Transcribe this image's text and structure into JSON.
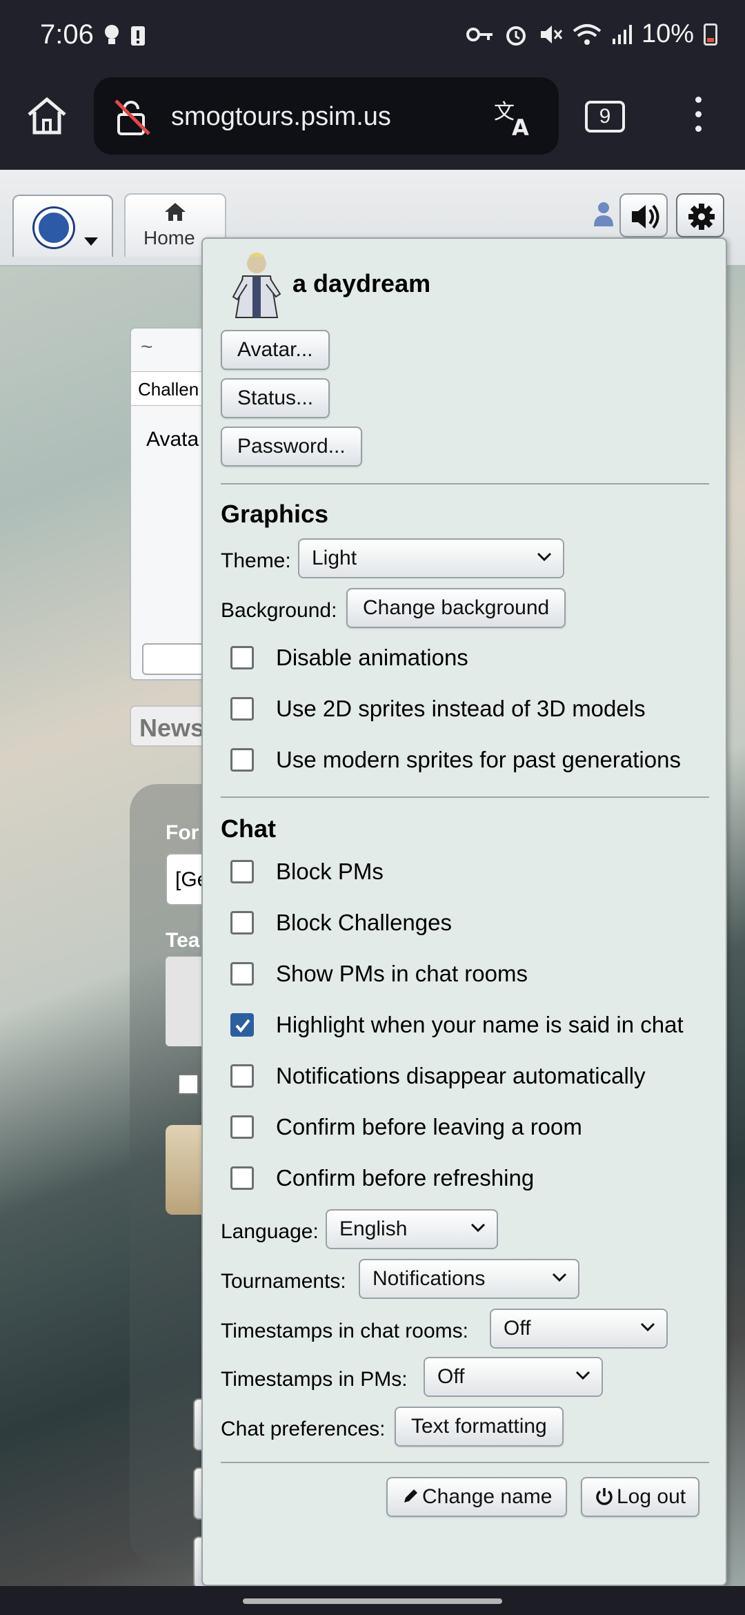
{
  "status_bar": {
    "time": "7:06",
    "battery": "10%"
  },
  "browser": {
    "url": "smogtours.psim.us",
    "tab_count": "9"
  },
  "site": {
    "home_tab": "Home"
  },
  "background": {
    "tilde": "~",
    "challenge_label": "Challen",
    "avatar_label": "Avata",
    "news_label": "News",
    "format_label": "For",
    "format_value": "[Ge",
    "team_label": "Tea"
  },
  "popup": {
    "username": "a daydream",
    "buttons": {
      "avatar": "Avatar...",
      "status": "Status...",
      "password": "Password..."
    },
    "graphics": {
      "heading": "Graphics",
      "theme_label": "Theme:",
      "theme_value": "Light",
      "background_label": "Background:",
      "background_button": "Change background",
      "options": [
        {
          "label": "Disable animations",
          "checked": false
        },
        {
          "label": "Use 2D sprites instead of 3D models",
          "checked": false
        },
        {
          "label": "Use modern sprites for past generations",
          "checked": false
        }
      ]
    },
    "chat": {
      "heading": "Chat",
      "options": [
        {
          "label": "Block PMs",
          "checked": false
        },
        {
          "label": "Block Challenges",
          "checked": false
        },
        {
          "label": "Show PMs in chat rooms",
          "checked": false
        },
        {
          "label": "Highlight when your name is said in chat",
          "checked": true
        },
        {
          "label": "Notifications disappear automatically",
          "checked": false
        },
        {
          "label": "Confirm before leaving a room",
          "checked": false
        },
        {
          "label": "Confirm before refreshing",
          "checked": false
        }
      ],
      "language_label": "Language:",
      "language_value": "English",
      "tournaments_label": "Tournaments:",
      "tournaments_value": "Notifications",
      "timestamps_rooms_label": "Timestamps in chat rooms:",
      "timestamps_rooms_value": "Off",
      "timestamps_pms_label": "Timestamps in PMs:",
      "timestamps_pms_value": "Off",
      "chat_prefs_label": "Chat preferences:",
      "chat_prefs_button": "Text formatting"
    },
    "footer": {
      "change_name": "Change name",
      "log_out": "Log out"
    }
  },
  "colors": {
    "checkbox_checked": "#2c5f9e",
    "popup_bg": "#e3ebe9"
  }
}
